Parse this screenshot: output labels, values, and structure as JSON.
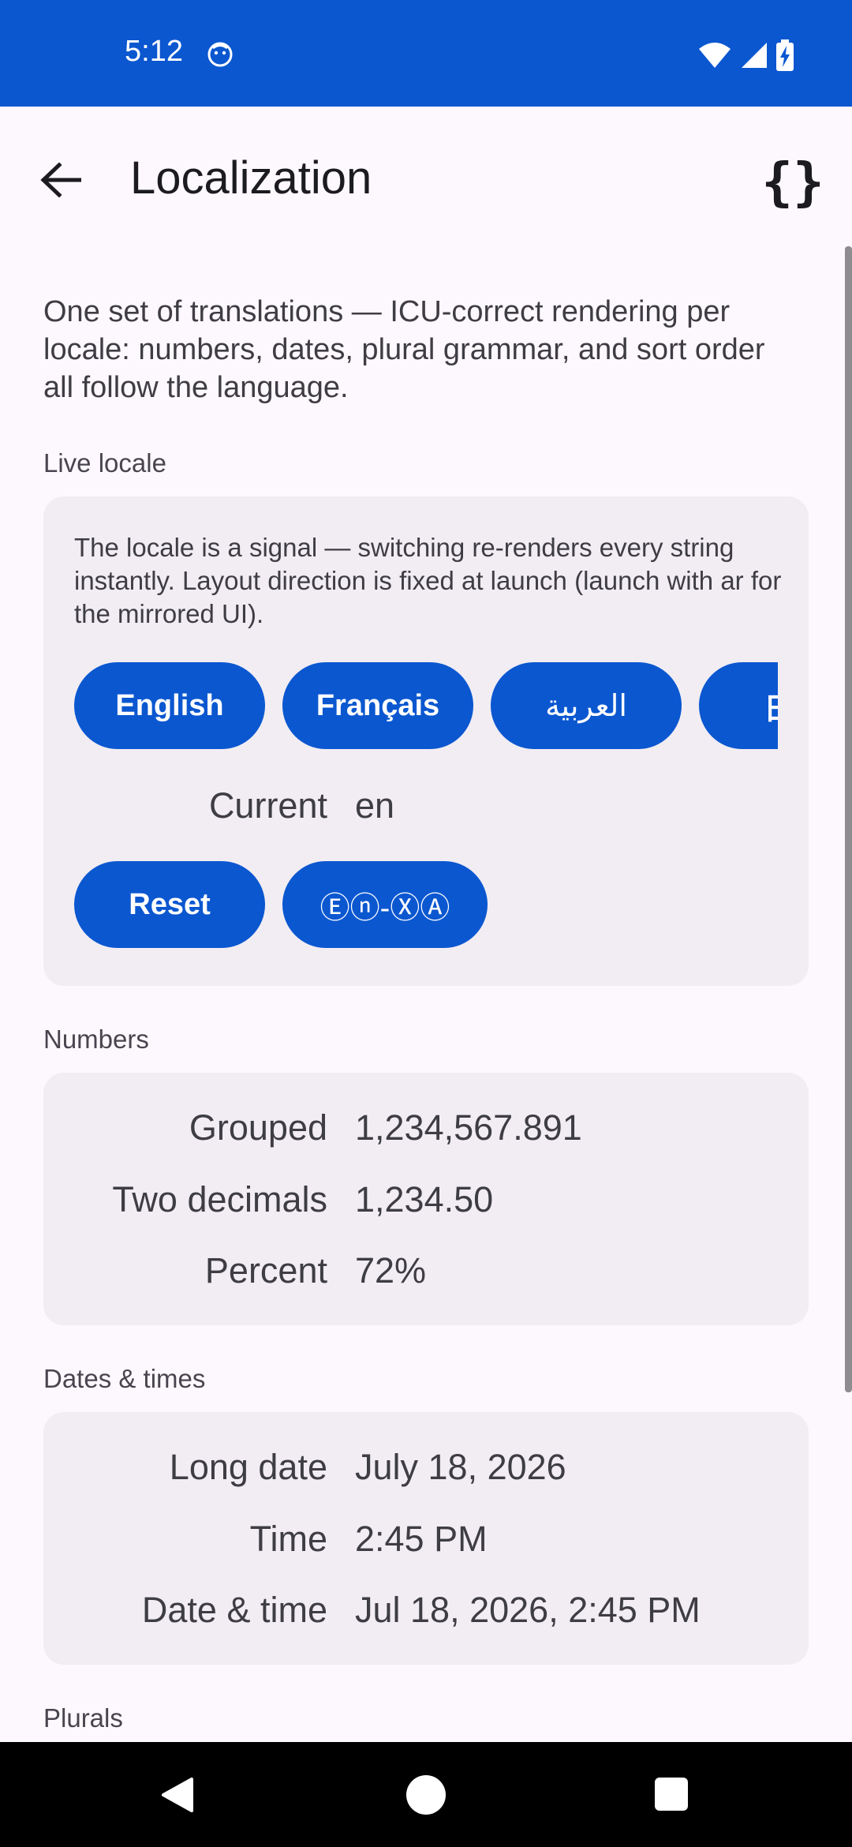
{
  "status_bar": {
    "time": "5:12",
    "icons": [
      "face-icon",
      "wifi-icon",
      "signal-icon",
      "battery-charging-icon"
    ]
  },
  "app_bar": {
    "title": "Localization",
    "code_symbol": "{}"
  },
  "intro": "One set of translations — ICU-correct rendering per locale: numbers, dates, plural grammar, and sort order all follow the language.",
  "live_locale": {
    "label": "Live locale",
    "description": "The locale is a signal — switching re-renders every string instantly. Layout direction is fixed at launch (launch with ar for the mirrored UI).",
    "locale_buttons": [
      "English",
      "Français",
      "العربية",
      "日本語"
    ],
    "current_label": "Current",
    "current_value": "en",
    "reset_label": "Reset",
    "pseudo_label": "Ⓔⓝ-ⓍⒶ"
  },
  "numbers": {
    "label": "Numbers",
    "rows": [
      {
        "label": "Grouped",
        "value": "1,234,567.891"
      },
      {
        "label": "Two decimals",
        "value": "1,234.50"
      },
      {
        "label": "Percent",
        "value": "72%"
      }
    ]
  },
  "dates": {
    "label": "Dates & times",
    "rows": [
      {
        "label": "Long date",
        "value": "July 18, 2026"
      },
      {
        "label": "Time",
        "value": "2:45 PM"
      },
      {
        "label": "Date & time",
        "value": "Jul 18, 2026, 2:45 PM"
      }
    ]
  },
  "plurals": {
    "label": "Plurals"
  },
  "colors": {
    "primary": "#0b57d0",
    "card": "#f1edf3",
    "background": "#fdf8fd"
  }
}
